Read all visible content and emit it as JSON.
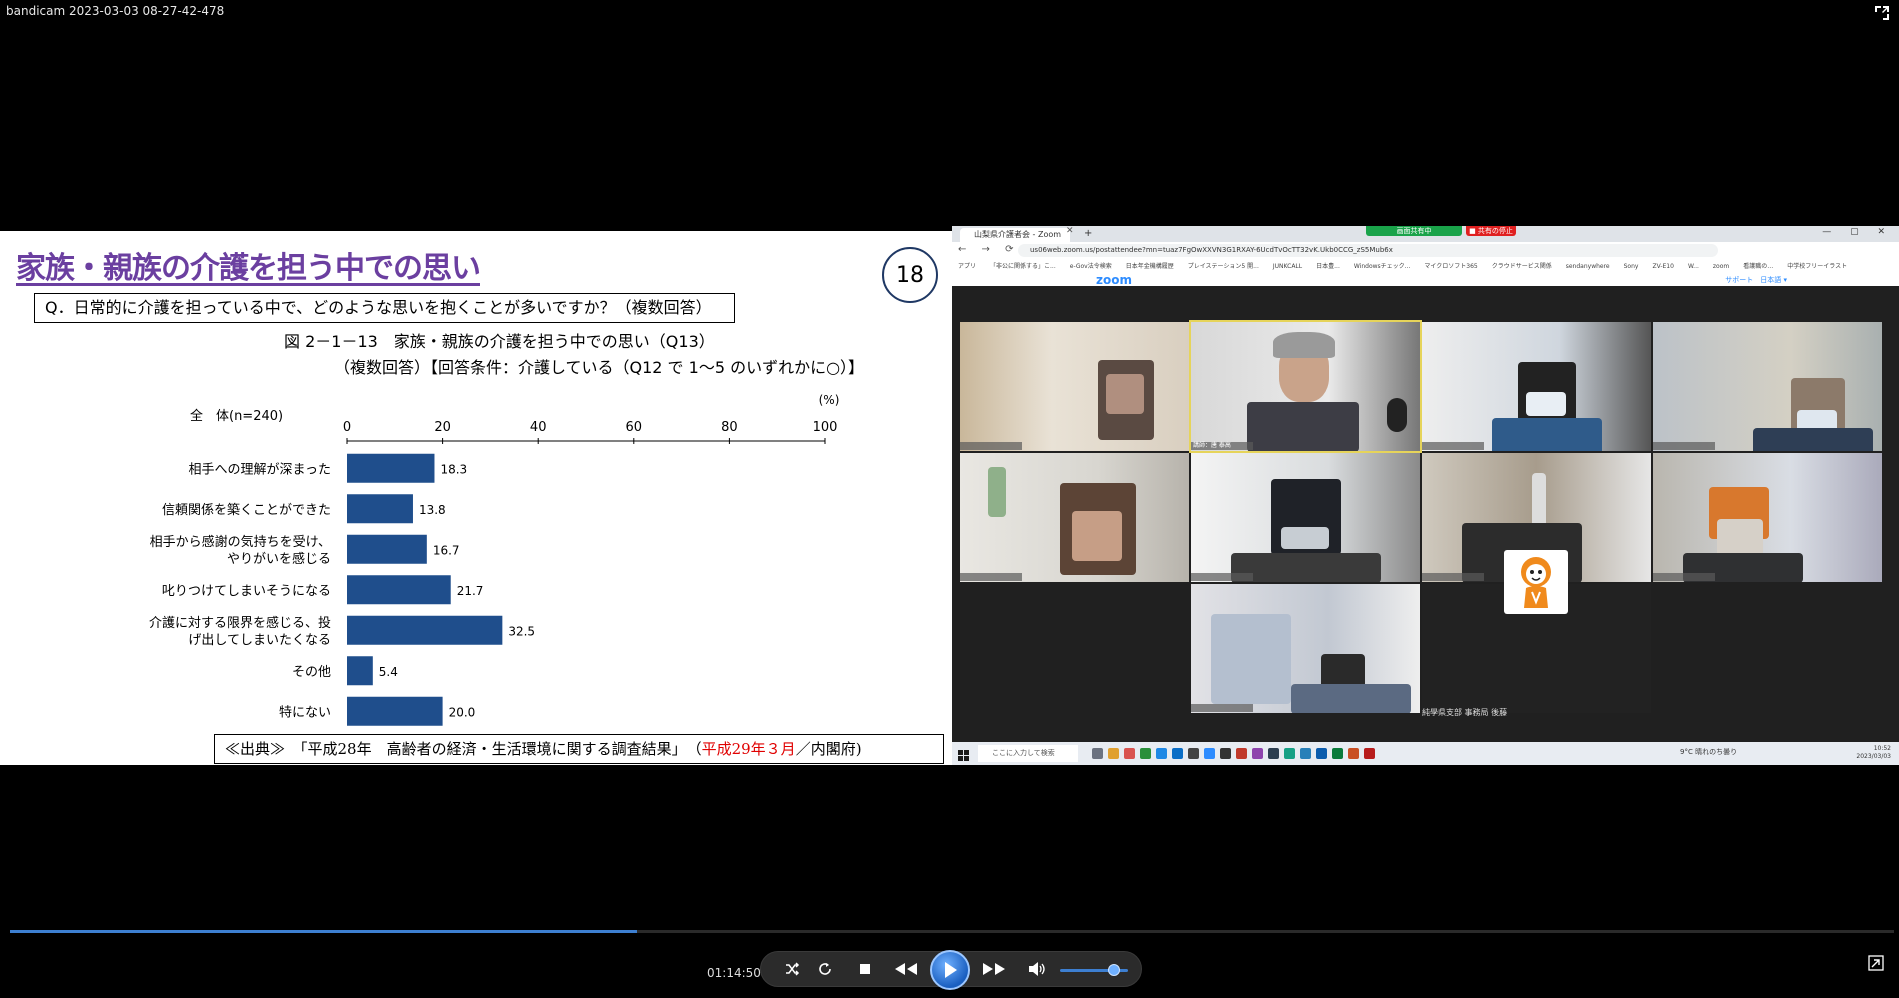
{
  "recorder": {
    "title": "bandicam 2023-03-03 08-27-42-478"
  },
  "slide": {
    "title": "家族・親族の介護を担う中での思い",
    "page_number": "18",
    "question": "Q．日常的に介護を担っている中で、どのような思いを抱くことが多いですか？（複数回答）",
    "figure_title": "図 2－1－13　家族・親族の介護を担う中での思い（Q13）",
    "figure_subtitle": "（複数回答）【回答条件：介護している（Q12 で 1～5 のいずれかに○）】",
    "source_prefix": "≪出典≫　「平成28年　高齢者の経済・生活環境に関する調査結果」　（",
    "source_date": "平成29年３月",
    "source_suffix": "／内閣府)"
  },
  "chart_data": {
    "type": "bar",
    "orientation": "horizontal",
    "group_label": "全　体(n=240)",
    "unit_label": "(%)",
    "xlim": [
      0,
      100
    ],
    "ticks": [
      "0",
      "20",
      "40",
      "60",
      "80",
      "100"
    ],
    "categories": [
      [
        "相手への理解が深まった"
      ],
      [
        "信頼関係を築くことができた"
      ],
      [
        "相手から感謝の気持ちを受け、",
        "やりがいを感じる"
      ],
      [
        "叱りつけてしまいそうになる"
      ],
      [
        "介護に対する限界を感じる、投",
        "げ出してしまいたくなる"
      ],
      [
        "その他"
      ],
      [
        "特にない"
      ]
    ],
    "values": [
      18.3,
      13.8,
      16.7,
      21.7,
      32.5,
      5.4,
      20.0
    ],
    "value_labels": [
      "18.3",
      "13.8",
      "16.7",
      "21.7",
      "32.5",
      "5.4",
      "20.0"
    ],
    "bar_color": "#1f4e8c"
  },
  "zoom": {
    "tab_title": "山梨県介護者会 - Zoom",
    "share_label": "画面共有中",
    "stop_share_label": "■ 共有の停止",
    "url": "us06web.zoom.us/postattendee?mn=tuaz7FgOwXXVN3G1RXAY-6UcdTvOcTT32vK.Ukb0CCG_zS5Mub6x",
    "bookmarks": [
      "アプリ",
      "「非公に関係する」こ...",
      "e-Gov法令検索",
      "日本年金機構履歴",
      "プレイステーション5 開...",
      "JUNKCALL",
      "日本豊...",
      "Windowsチェック...",
      "マイクロソフト365",
      "クラウドサービス関係",
      "sendanywhere",
      "Sony",
      "ZV-E10",
      "W...",
      "zoom",
      "看護職の…",
      "中学校フリーイラスト"
    ],
    "logo": "zoom",
    "support": "サポート　日本語 ▾",
    "speaker_name": "講師：唐 泰高",
    "avatar_name": "純學県支部 事務局 後藤",
    "taskbar_search": "ここに入力して検索",
    "weather": "9°C 晴れのち曇り",
    "clock_time": "10:52",
    "clock_date": "2023/03/03"
  },
  "player": {
    "time": "01:14:50",
    "progress": 0.333,
    "volume": 0.8
  }
}
